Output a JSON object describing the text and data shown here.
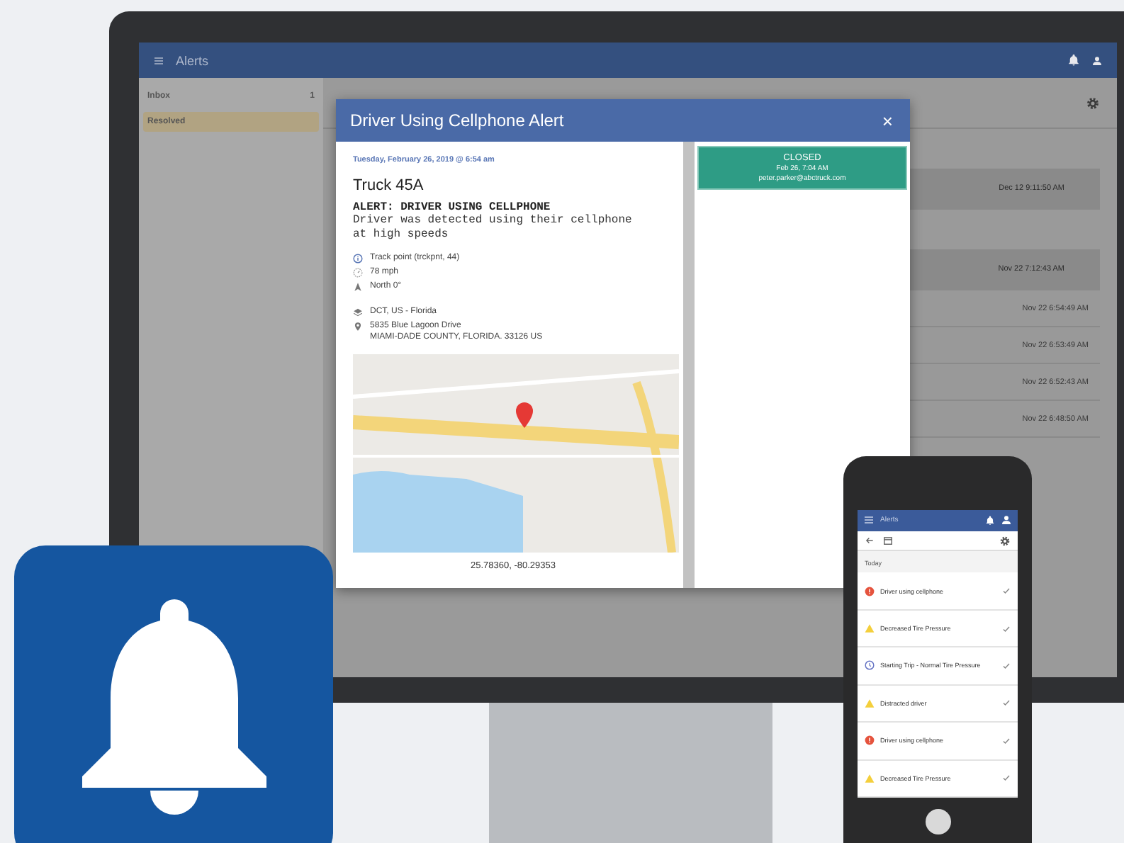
{
  "app": {
    "title": "Alerts"
  },
  "sidebar": {
    "items": [
      {
        "label": "Inbox",
        "count": "1",
        "selected": false
      },
      {
        "label": "Resolved",
        "selected": true
      }
    ]
  },
  "alert_list": [
    {
      "kind": "card",
      "time": "Dec 12 9:11:50 AM"
    },
    {
      "kind": "card",
      "time": "Nov 22 7:12:43 AM"
    },
    {
      "kind": "row",
      "time": "Nov 22 6:54:49 AM"
    },
    {
      "kind": "row",
      "time": "Nov 22 6:53:49 AM"
    },
    {
      "kind": "row",
      "time": "Nov 22 6:52:43 AM"
    },
    {
      "kind": "row",
      "time": "Nov 22 6:48:50 AM"
    }
  ],
  "dialog": {
    "title": "Driver Using Cellphone Alert",
    "close": "×",
    "timestamp": "Tuesday, February 26, 2019 @ 6:54 am",
    "vehicle": "Truck 45A",
    "headline": "ALERT: DRIVER USING CELLPHONE",
    "description": "Driver was detected using their cellphone at high speeds",
    "details": [
      {
        "kind": "info",
        "text": "Track point (trckpnt, 44)"
      },
      {
        "kind": "speed",
        "text": "78 mph"
      },
      {
        "kind": "heading",
        "text": "North 0°"
      }
    ],
    "location": [
      {
        "kind": "region",
        "lines": [
          "DCT, US - Florida"
        ]
      },
      {
        "kind": "address",
        "lines": [
          "5835 Blue Lagoon Drive",
          "MIAMI-DADE COUNTY, FLORIDA. 33126 US"
        ]
      }
    ],
    "coordinates": "25.78360, -80.29353",
    "status": {
      "label": "CLOSED",
      "time": "Feb 26, 7:04 AM",
      "user": "peter.parker@abctruck.com"
    }
  },
  "phone": {
    "title": "Alerts",
    "section": "Today",
    "alerts": [
      {
        "kind": "critical",
        "title": "Driver using cellphone"
      },
      {
        "kind": "warning",
        "title": "Decreased Tire Pressure"
      },
      {
        "kind": "info",
        "title": "Starting Trip - Normal Tire Pressure"
      },
      {
        "kind": "warning",
        "title": "Distracted driver"
      },
      {
        "kind": "critical",
        "title": "Driver using cellphone"
      },
      {
        "kind": "warning",
        "title": "Decreased Tire Pressure"
      }
    ]
  }
}
